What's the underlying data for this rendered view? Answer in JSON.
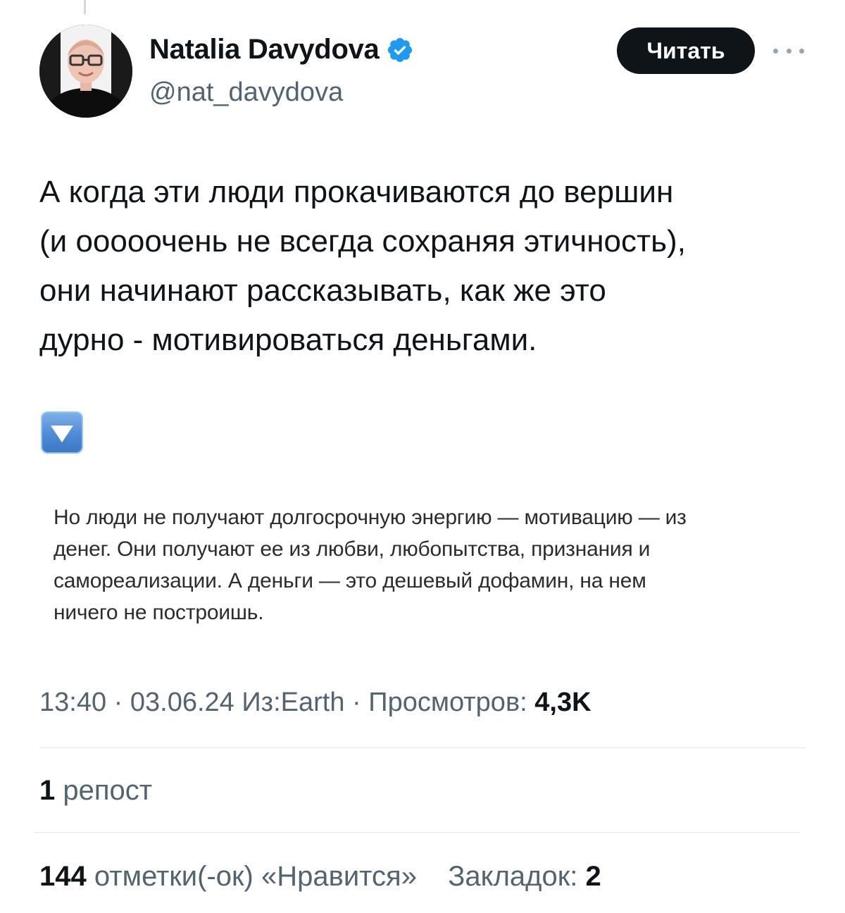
{
  "author": {
    "name": "Natalia Davydova",
    "handle": "@nat_davydova"
  },
  "header": {
    "follow_label": "Читать"
  },
  "tweet": {
    "lines": [
      "А когда эти люди прокачиваются до вершин",
      "(и ооооочень не всегда сохраняя этичность),",
      "они начинают рассказывать, как же это",
      "дурно - мотивироваться деньгами."
    ],
    "emoji": "arrow-down-button-icon"
  },
  "quote_image": {
    "lines": [
      "Но люди не получают долгосрочную энергию — мотивацию — из",
      "денег. Они получают ее из любви, любопытства, признания и",
      "самореализации. А деньги — это дешевый дофамин, на нем",
      "ничего не построишь."
    ]
  },
  "meta": {
    "time": "13:40",
    "date": "03.06.24",
    "source": "Из:Earth",
    "views_label": "Просмотров:",
    "views": "4,3K"
  },
  "stats": {
    "reposts_count": "1",
    "reposts_label": "репост",
    "likes_count": "144",
    "likes_label": "отметки(-ок) «Нравится»",
    "bookmarks_label": "Закладок:",
    "bookmarks_count": "2"
  },
  "colors": {
    "text": "#0f1419",
    "secondary": "#536471",
    "verified": "#1d9bf0",
    "button": "#0f1419"
  }
}
